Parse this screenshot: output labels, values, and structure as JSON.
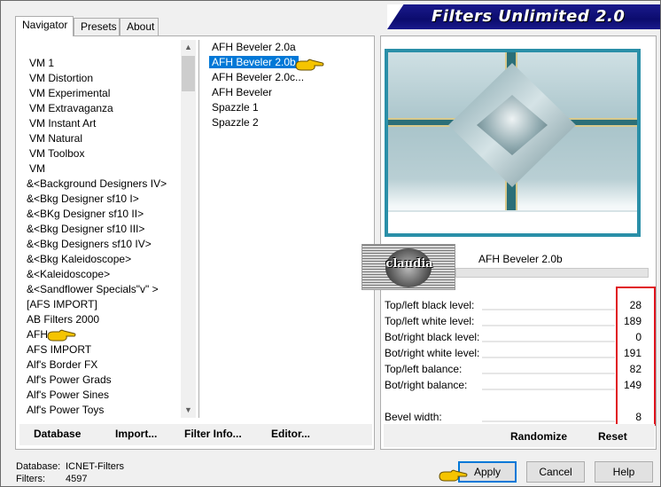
{
  "window": {
    "title": "Filters Unlimited 2.0"
  },
  "tabs": [
    {
      "label": "Navigator",
      "active": true
    },
    {
      "label": "Presets",
      "active": false
    },
    {
      "label": "About",
      "active": false
    }
  ],
  "categories": [
    "VM 1",
    "VM Distortion",
    "VM Experimental",
    "VM Extravaganza",
    "VM Instant Art",
    "VM Natural",
    "VM Toolbox",
    "VM",
    "&<Background Designers IV>",
    "&<Bkg Designer sf10 I>",
    "&<BKg Designer sf10 II>",
    "&<Bkg Designer sf10 III>",
    "&<Bkg Designers sf10 IV>",
    "&<Bkg Kaleidoscope>",
    "&<Kaleidoscope>",
    "&<Sandflower Specials\"v\" >",
    "[AFS IMPORT]",
    "AB Filters 2000",
    "AFH",
    "AFS IMPORT",
    "Alf's Border FX",
    "Alf's Power Grads",
    "Alf's Power Sines",
    "Alf's Power Toys"
  ],
  "selected_category": "AFH",
  "filters": [
    "AFH Beveler 2.0a",
    "AFH Beveler 2.0b",
    "AFH Beveler 2.0c...",
    "AFH Beveler",
    "Spazzle 1",
    "Spazzle 2"
  ],
  "selected_filter": "AFH Beveler 2.0b",
  "left_buttons": {
    "database": "Database",
    "import": "Import...",
    "filter_info": "Filter Info...",
    "editor": "Editor..."
  },
  "preview": {
    "filter_name": "AFH Beveler 2.0b",
    "logo_text": "claudia"
  },
  "parameters": [
    {
      "label": "Top/left black level:",
      "value": "28"
    },
    {
      "label": "Top/left white level:",
      "value": "189"
    },
    {
      "label": "Bot/right black level:",
      "value": "0"
    },
    {
      "label": "Bot/right white level:",
      "value": "191"
    },
    {
      "label": "Top/left balance:",
      "value": "82"
    },
    {
      "label": "Bot/right balance:",
      "value": "149"
    },
    {
      "label": "Bevel width:",
      "value": "8"
    }
  ],
  "right_buttons": {
    "randomize": "Randomize",
    "reset": "Reset"
  },
  "footer": {
    "database_label": "Database:",
    "database_value": "ICNET-Filters",
    "filters_label": "Filters:",
    "filters_value": "4597"
  },
  "dialog_buttons": {
    "apply": "Apply",
    "cancel": "Cancel",
    "help": "Help"
  },
  "colors": {
    "selection": "#0078d7",
    "banner": "#0c0c6e",
    "highlight_box": "#e0141e",
    "pointer": "#f5c400"
  }
}
